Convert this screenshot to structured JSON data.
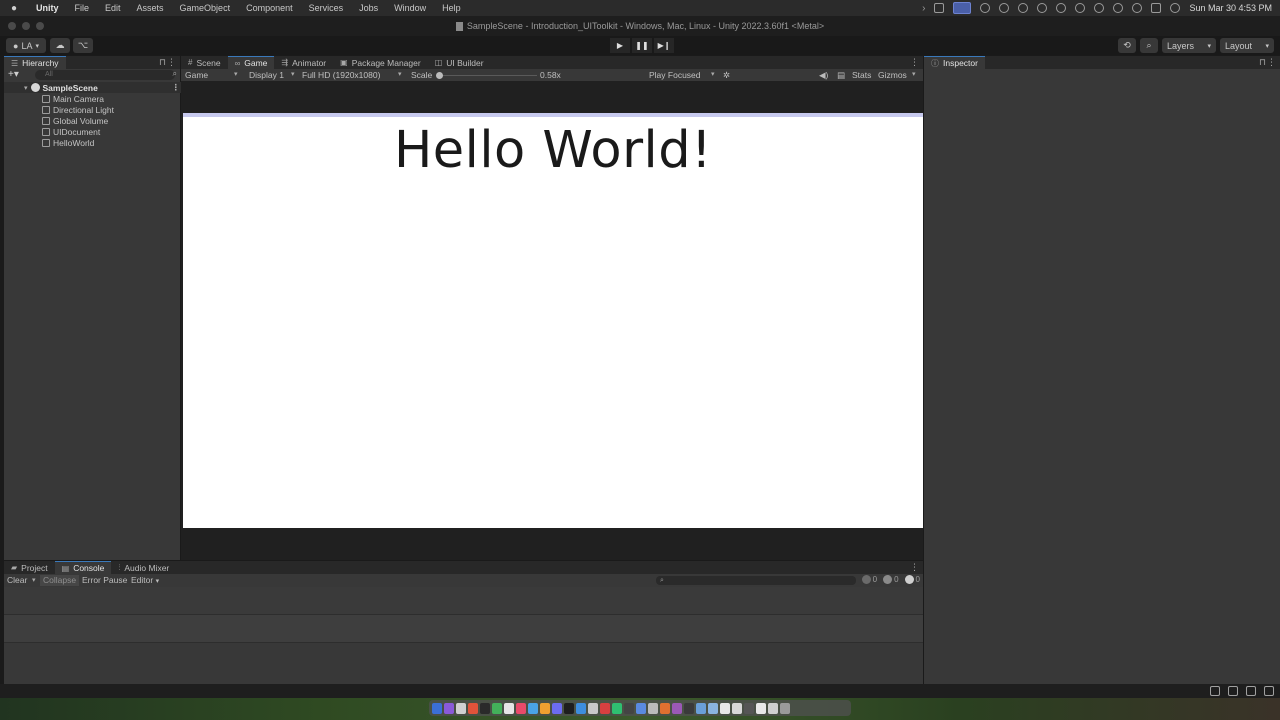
{
  "menubar": {
    "items": [
      "Unity",
      "File",
      "Edit",
      "Assets",
      "GameObject",
      "Component",
      "Services",
      "Jobs",
      "Window",
      "Help"
    ],
    "clock": "Sun Mar 30  4:53 PM"
  },
  "window": {
    "title": "SampleScene - Introduction_UIToolkit - Windows, Mac, Linux - Unity 2022.3.60f1 <Metal>"
  },
  "toolbar": {
    "account": "LA",
    "layers": "Layers",
    "layout": "Layout"
  },
  "hierarchy": {
    "tab": "Hierarchy",
    "search_placeholder": "All",
    "scene": "SampleScene",
    "objects": [
      "Main Camera",
      "Directional Light",
      "Global Volume",
      "UIDocument",
      "HelloWorld"
    ]
  },
  "center_tabs": [
    "Scene",
    "Game",
    "Animator",
    "Package Manager",
    "UI Builder"
  ],
  "game_view": {
    "mode": "Game",
    "display": "Display 1",
    "resolution": "Full HD (1920x1080)",
    "scale_label": "Scale",
    "scale_value": "0.58x",
    "play_mode": "Play Focused",
    "stats": "Stats",
    "gizmos": "Gizmos",
    "content_text": "Hello World!"
  },
  "inspector": {
    "tab": "Inspector"
  },
  "bottom_tabs": [
    "Project",
    "Console",
    "Audio Mixer"
  ],
  "console": {
    "clear": "Clear",
    "collapse": "Collapse",
    "error_pause": "Error Pause",
    "editor": "Editor",
    "error_count": "0",
    "warning_count": "0",
    "info_count": "0"
  },
  "colors": {
    "editor_bg": "#383838",
    "canvas_bg": "#ffffff",
    "canvas_top_border": "#c7c9ee",
    "active_tab_accent": "#3a79bb"
  }
}
